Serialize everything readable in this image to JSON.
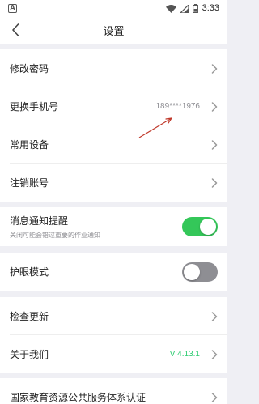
{
  "status_bar": {
    "app_badge": "A",
    "icons": [
      "wifi-icon",
      "signal-icon",
      "battery-icon"
    ],
    "time": "3:33"
  },
  "nav": {
    "back_icon": "chevron-left-icon",
    "title": "设置"
  },
  "groups": [
    {
      "rows": [
        {
          "label": "修改密码"
        },
        {
          "label": "更换手机号",
          "value": "189****1976"
        },
        {
          "label": "常用设备"
        },
        {
          "label": "注销账号"
        }
      ]
    },
    {
      "rows": [
        {
          "label": "消息通知提醒",
          "sub": "关闭可能会错过重要的作业通知",
          "toggle": true
        }
      ]
    },
    {
      "rows": [
        {
          "label": "护眼模式",
          "toggle": false
        }
      ]
    },
    {
      "rows": [
        {
          "label": "检查更新"
        },
        {
          "label": "关于我们",
          "value": "V 4.13.1"
        }
      ]
    },
    {
      "rows": [
        {
          "label": "国家教育资源公共服务体系认证"
        }
      ]
    }
  ],
  "colors": {
    "accent_green": "#34c759",
    "version_green": "#2ecc71",
    "annotation_arrow": "#c0392b"
  }
}
